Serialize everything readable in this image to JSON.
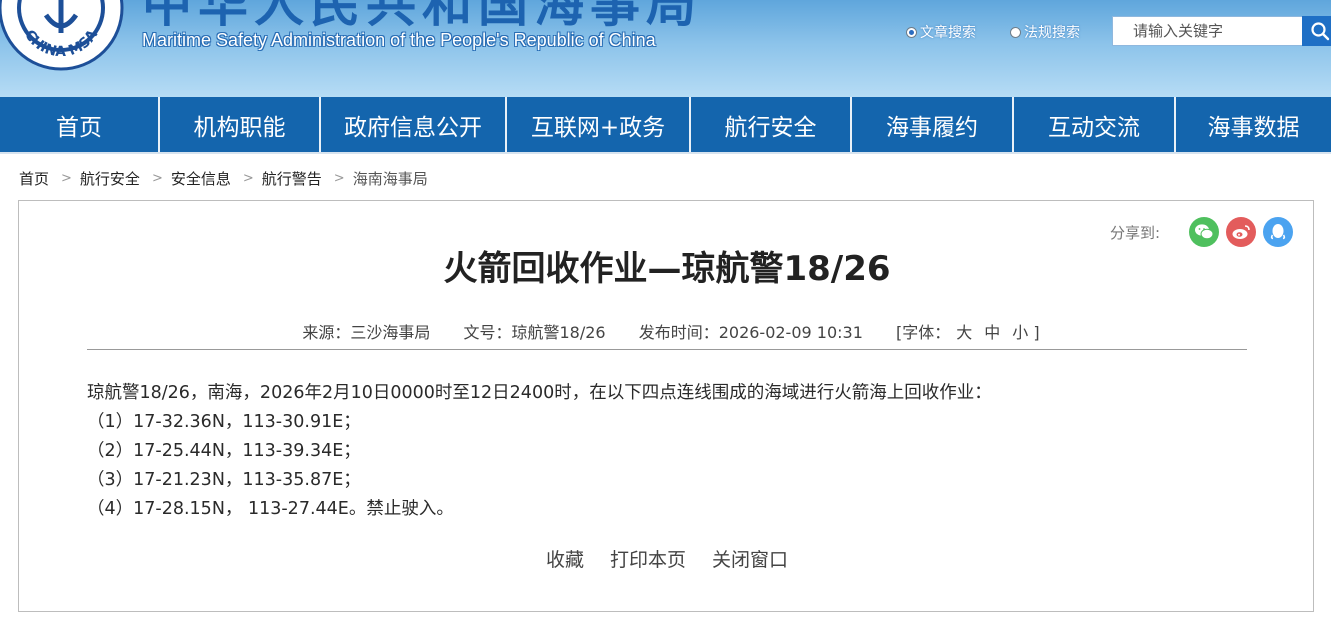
{
  "header": {
    "title_cn": "中华人民共和国海事局",
    "title_en": "Maritime Safety Administration of the People's Republic of China",
    "logo_text": "CHINA MSA",
    "search": {
      "radio_article": "文章搜索",
      "radio_law": "法规搜索",
      "selected": "文章搜索",
      "placeholder": "请输入关键字",
      "button_icon": "search-icon"
    }
  },
  "nav": {
    "items": [
      "首页",
      "机构职能",
      "政府信息公开",
      "互联网+政务",
      "航行安全",
      "海事履约",
      "互动交流",
      "海事数据"
    ]
  },
  "breadcrumb": {
    "items": [
      "首页",
      "航行安全",
      "安全信息",
      "航行警告",
      "海南海事局"
    ],
    "separator": ">"
  },
  "article": {
    "share_label": "分享到:",
    "share_icons": [
      "wechat-icon",
      "weibo-icon",
      "qq-icon"
    ],
    "title": "火箭回收作业—琼航警18/26",
    "meta": {
      "source": "来源：三沙海事局",
      "doc_no": "文号：琼航警18/26",
      "published": "发布时间：2026-02-09 10:31",
      "font_label": "[字体：",
      "font_large": "大",
      "font_medium": "中",
      "font_small": "小 ]"
    },
    "body": [
      "琼航警18/26，南海，2026年2月10日0000时至12日2400时，在以下四点连线围成的海域进行火箭海上回收作业：",
      "（1）17-32.36N，113-30.91E；",
      "（2）17-25.44N，113-39.34E；",
      "（3）17-21.23N，113-35.87E；",
      "（4）17-28.15N， 113-27.44E。禁止驶入。"
    ],
    "actions": {
      "favorite": "收藏",
      "print": "打印本页",
      "close": "关闭窗口"
    }
  },
  "colors": {
    "nav_bg": "#1465ad",
    "header_gradient_top": "#5fa6dc",
    "title_blue": "#1d63b0",
    "wechat": "#4fc05e",
    "weibo": "#e35c5c",
    "qq": "#4ba3f0"
  }
}
